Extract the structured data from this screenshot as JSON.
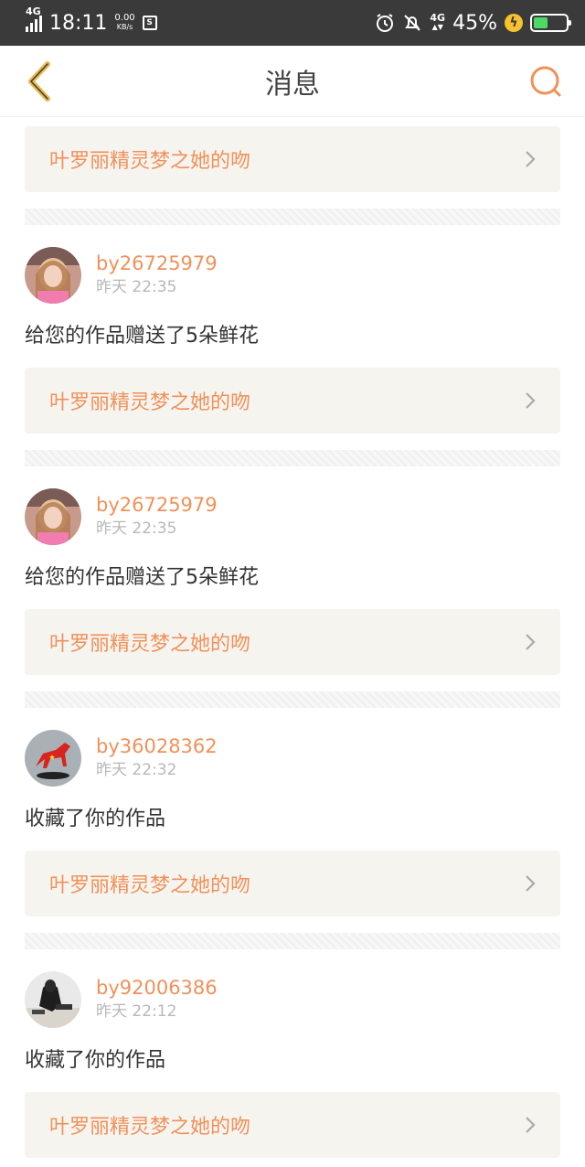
{
  "status_bar": {
    "network": "4G",
    "time": "18:11",
    "speed_value": "0.00",
    "speed_unit": "KB/s",
    "network_right": "4G",
    "battery": "45%",
    "battery_level": 0.45
  },
  "header": {
    "title": "消息",
    "back_icon": "chevron-left-icon",
    "search_icon": "search-icon"
  },
  "messages": [
    {
      "work_title": "叶罗丽精灵梦之她的吻"
    },
    {
      "user": "by26725979",
      "time": "昨天 22:35",
      "action": "给您的作品赠送了5朵鲜花",
      "work_title": "叶罗丽精灵梦之她的吻"
    },
    {
      "user": "by26725979",
      "time": "昨天 22:35",
      "action": "给您的作品赠送了5朵鲜花",
      "work_title": "叶罗丽精灵梦之她的吻"
    },
    {
      "user": "by36028362",
      "time": "昨天 22:32",
      "action": "收藏了你的作品",
      "work_title": "叶罗丽精灵梦之她的吻"
    },
    {
      "user": "by92006386",
      "time": "昨天 22:12",
      "action": "收藏了你的作品",
      "work_title": "叶罗丽精灵梦之她的吻"
    }
  ],
  "colors": {
    "accent": "#f0915a",
    "back_arrow": "#e8b84a"
  }
}
